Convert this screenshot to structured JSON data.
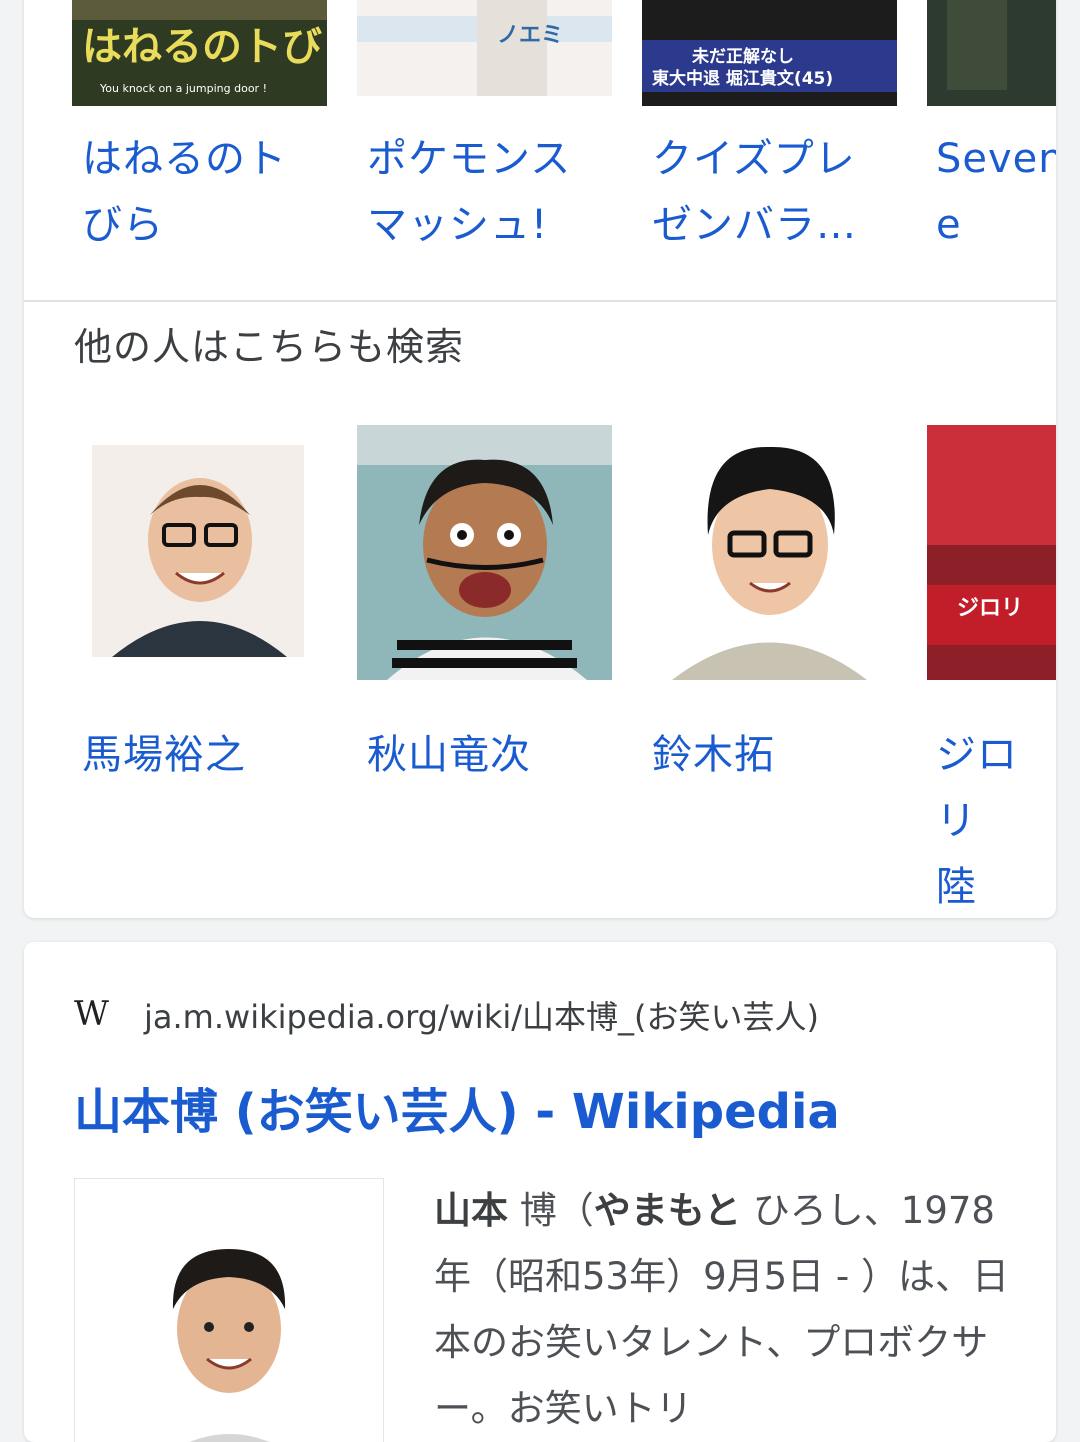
{
  "carousel_top": {
    "items": [
      {
        "label": "はねるのト\nびら",
        "thumb_text": "はねるのトびら IV",
        "thumb_caption": "You knock on a jumping door !"
      },
      {
        "label": "ポケモンス\nマッシュ!",
        "thumb_text": "ノエミ"
      },
      {
        "label": "クイズプレ\nゼンバラ…",
        "thumb_text": "未だ正解なし",
        "thumb_text2": "東大中退 堀江貴文(45)"
      },
      {
        "label": "Sevent\ne"
      }
    ]
  },
  "people_also_search": {
    "heading": "他の人はこちらも検索",
    "items": [
      {
        "label": "馬場裕之"
      },
      {
        "label": "秋山竜次"
      },
      {
        "label": "鈴木拓"
      },
      {
        "label": "ジロリ\n陸",
        "thumb_text": "ジロリ"
      }
    ]
  },
  "result": {
    "source_icon": "W",
    "url": "ja.m.wikipedia.org/wiki/山本博_(お笑い芸人)",
    "title": "山本博 (お笑い芸人) - Wikipedia",
    "snippet": {
      "bold1": "山本",
      "text1": " 博（",
      "bold2": "やまもと",
      "text2": " ひろし、1978年（昭和53年）9月5日 - ）は、日本のお笑いタレント、プロボクサー。お笑いトリ"
    }
  }
}
